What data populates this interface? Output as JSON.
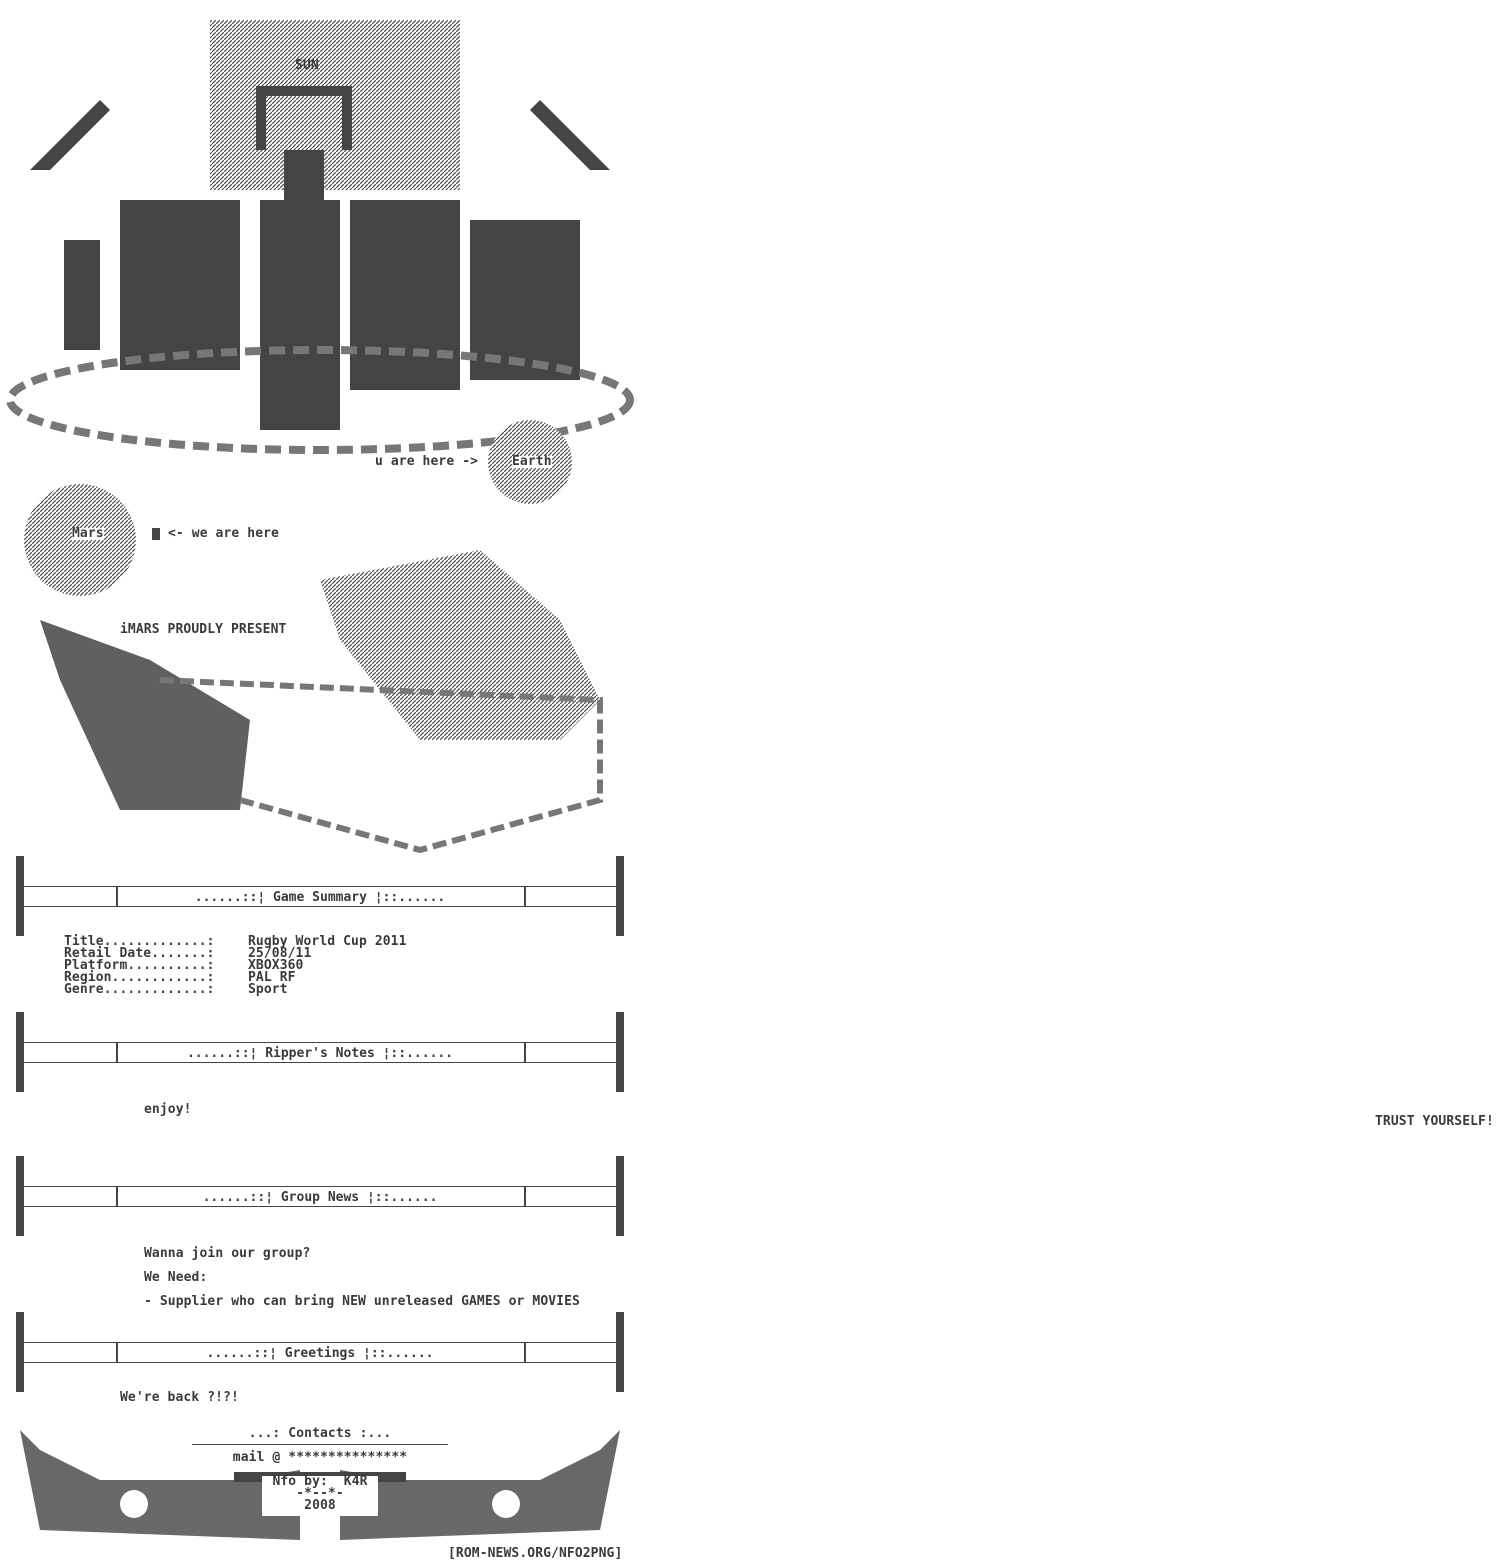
{
  "art": {
    "sun_label": "SUN",
    "logo_text": "iMARS",
    "earth_pointer": "u are here ->",
    "earth_label": "Earth",
    "mars_label": "Mars",
    "mars_pointer": "<- we are here",
    "present": "iMARS PROUDLY PRESENT"
  },
  "game_summary": {
    "header": "......::¦ Game Summary ¦::......",
    "rows": [
      {
        "label": "Title.............:",
        "value": "Rugby World Cup 2011"
      },
      {
        "label": "Retail Date.......:",
        "value": "25/08/11"
      },
      {
        "label": "Platform..........:",
        "value": "XBOX360"
      },
      {
        "label": "Region............:",
        "value": "PAL RF"
      },
      {
        "label": "Genre.............:",
        "value": "Sport"
      }
    ]
  },
  "rippers_notes": {
    "header": "......::¦ Ripper's Notes ¦::......",
    "text": "enjoy!"
  },
  "side_text": "TRUST YOURSELF!",
  "group_news": {
    "header": "......::¦ Group News ¦::......",
    "lines": [
      "Wanna join our group?",
      "We Need:",
      "- Supplier who can bring NEW unreleased GAMES or MOVIES"
    ]
  },
  "greetings": {
    "header": "......::¦ Greetings ¦::......",
    "text": "We're back ?!?!"
  },
  "contacts": {
    "header": "...: Contacts :...",
    "mail": "mail @ ***************",
    "nfo_by": "Nfo by:  K4R",
    "separator": "-*--*-",
    "year": "2008"
  },
  "footer": "[ROM-NEWS.ORG/NFO2PNG]"
}
